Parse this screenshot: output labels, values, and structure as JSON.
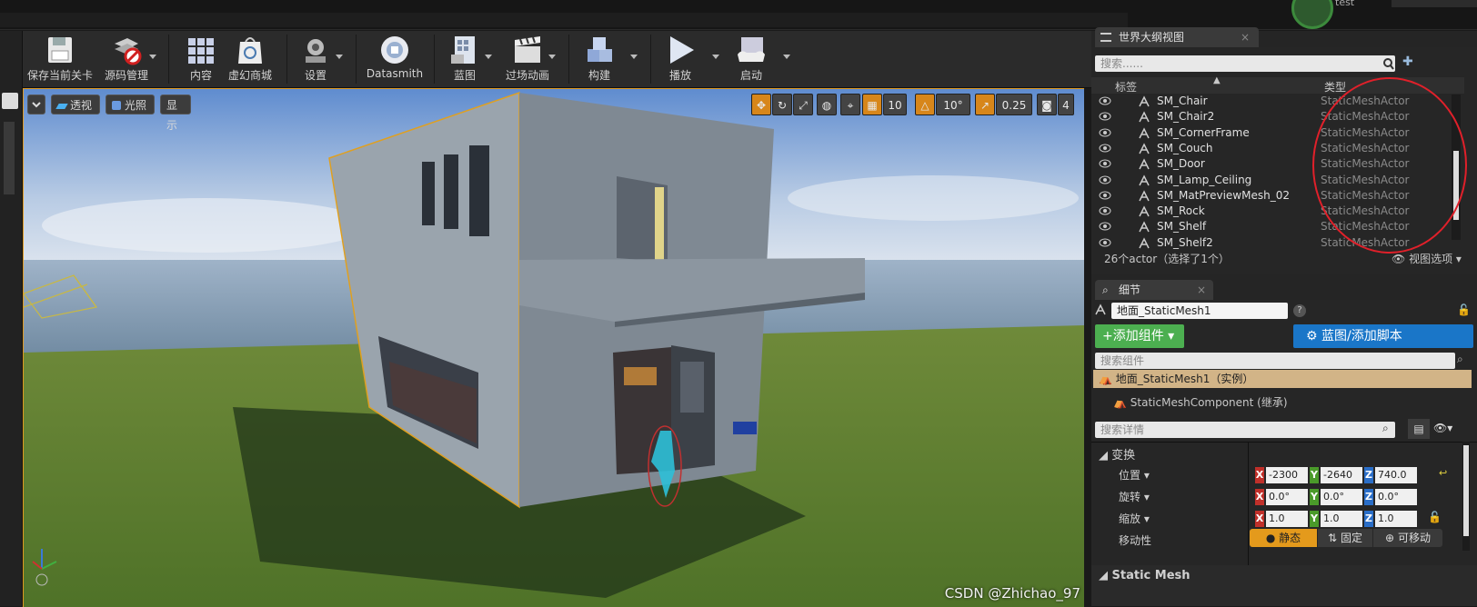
{
  "top": {
    "project_label": "test"
  },
  "toolbar": {
    "items": [
      {
        "label": "保存当前关卡"
      },
      {
        "label": "源码管理"
      },
      {
        "label": "内容"
      },
      {
        "label": "虚幻商城"
      },
      {
        "label": "设置"
      },
      {
        "label": "Datasmith"
      },
      {
        "label": "蓝图"
      },
      {
        "label": "过场动画"
      },
      {
        "label": "构建"
      },
      {
        "label": "播放"
      },
      {
        "label": "启动"
      }
    ]
  },
  "viewport": {
    "perspective_label": "透视",
    "lighting_label": "光照",
    "show_label": "显示",
    "grid_snap": "10",
    "rotation_snap": "10°",
    "scale_snap": "0.25",
    "camera_speed": "4",
    "watermark": "CSDN @Zhichao_97"
  },
  "outliner": {
    "tab_title": "世界大纲视图",
    "search_placeholder": "搜索......",
    "col_label": "标签",
    "col_type": "类型",
    "rows": [
      {
        "name": "SM_Chair",
        "type": "StaticMeshActor"
      },
      {
        "name": "SM_Chair2",
        "type": "StaticMeshActor"
      },
      {
        "name": "SM_CornerFrame",
        "type": "StaticMeshActor"
      },
      {
        "name": "SM_Couch",
        "type": "StaticMeshActor"
      },
      {
        "name": "SM_Door",
        "type": "StaticMeshActor"
      },
      {
        "name": "SM_Lamp_Ceiling",
        "type": "StaticMeshActor"
      },
      {
        "name": "SM_MatPreviewMesh_02",
        "type": "StaticMeshActor"
      },
      {
        "name": "SM_Rock",
        "type": "StaticMeshActor"
      },
      {
        "name": "SM_Shelf",
        "type": "StaticMeshActor"
      },
      {
        "name": "SM_Shelf2",
        "type": "StaticMeshActor"
      }
    ],
    "status": "26个actor（选择了1个）",
    "view_options": "视图选项"
  },
  "details": {
    "tab_title": "细节",
    "actor_name": "地面_StaticMesh1",
    "add_component": "+添加组件",
    "blueprint_script": "蓝图/添加脚本",
    "search_components": "搜索组件",
    "instance_row": "地面_StaticMesh1（实例）",
    "component_row": "StaticMeshComponent (继承)",
    "search_details": "搜索详情",
    "transform_header": "变换",
    "location_label": "位置",
    "rotation_label": "旋转",
    "scale_label": "缩放",
    "mobility_label": "移动性",
    "location": {
      "x": "-2300",
      "y": "-2640",
      "z": "740.0"
    },
    "rotation": {
      "x": "0.0°",
      "y": "0.0°",
      "z": "0.0°"
    },
    "scale": {
      "x": "1.0",
      "y": "1.0",
      "z": "1.0"
    },
    "mobility": {
      "static": "静态",
      "stationary": "固定",
      "movable": "可移动"
    },
    "static_mesh_header": "Static Mesh"
  },
  "colors": {
    "accent": "#d7861a",
    "green_button": "#4caf50",
    "blue_button": "#1a76c8",
    "annotation": "#e0202a"
  }
}
